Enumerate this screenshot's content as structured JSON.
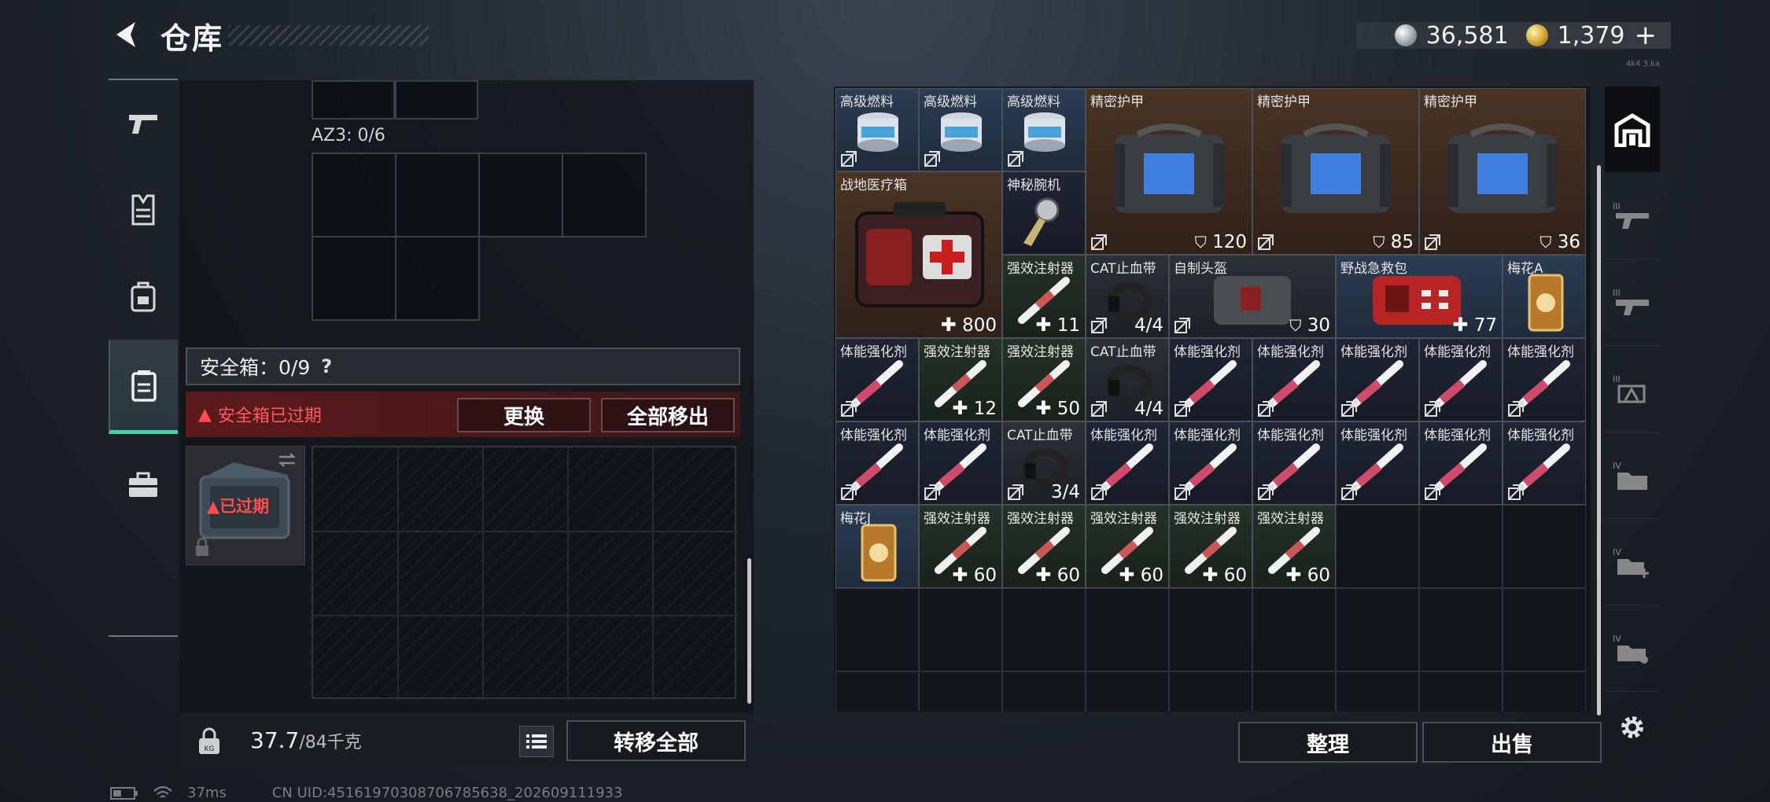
{
  "header": {
    "title": "仓库",
    "silver": "36,581",
    "gold": "1,379",
    "gold_plus": "+",
    "tiny_tag": "4k4 3:ka"
  },
  "left": {
    "az3_label": "AZ3: 0/6",
    "safe_title": "安全箱：0/9",
    "help": "?",
    "expired_msg": "安全箱已过期",
    "replace_btn": "更换",
    "move_all_out_btn": "全部移出",
    "expired_tag": "已过期",
    "weight_value": "37.7",
    "weight_max": "/84千克",
    "transfer_all_btn": "转移全部"
  },
  "inventory": {
    "sort_btn": "整理",
    "sell_btn": "出售",
    "items": [
      {
        "name": "高级燃料",
        "val": ""
      },
      {
        "name": "高级燃料",
        "val": ""
      },
      {
        "name": "高级燃料",
        "val": ""
      },
      {
        "name": "精密护甲",
        "val": "120"
      },
      {
        "name": "精密护甲",
        "val": "85"
      },
      {
        "name": "精密护甲",
        "val": "36"
      },
      {
        "name": "战地医疗箱",
        "val": "800"
      },
      {
        "name": "神秘腕机",
        "val": ""
      },
      {
        "name": "强效注射器",
        "val": "11"
      },
      {
        "name": "CAT止血带",
        "val": "4/4"
      },
      {
        "name": "自制头盔",
        "val": "30"
      },
      {
        "name": "野战急救包",
        "val": "77"
      },
      {
        "name": "梅花A",
        "val": ""
      },
      {
        "name": "体能强化剂",
        "val": ""
      },
      {
        "name": "强效注射器",
        "val": "12"
      },
      {
        "name": "强效注射器",
        "val": "50"
      },
      {
        "name": "CAT止血带",
        "val": "4/4"
      },
      {
        "name": "体能强化剂",
        "val": ""
      },
      {
        "name": "体能强化剂",
        "val": ""
      },
      {
        "name": "体能强化剂",
        "val": ""
      },
      {
        "name": "体能强化剂",
        "val": ""
      },
      {
        "name": "体能强化剂",
        "val": ""
      },
      {
        "name": "体能强化剂",
        "val": ""
      },
      {
        "name": "体能强化剂",
        "val": ""
      },
      {
        "name": "CAT止血带",
        "val": "3/4"
      },
      {
        "name": "体能强化剂",
        "val": ""
      },
      {
        "name": "体能强化剂",
        "val": ""
      },
      {
        "name": "体能强化剂",
        "val": ""
      },
      {
        "name": "体能强化剂",
        "val": ""
      },
      {
        "name": "体能强化剂",
        "val": ""
      },
      {
        "name": "体能强化剂",
        "val": ""
      },
      {
        "name": "梅花J",
        "val": ""
      },
      {
        "name": "强效注射器",
        "val": "60"
      },
      {
        "name": "强效注射器",
        "val": "60"
      },
      {
        "name": "强效注射器",
        "val": "60"
      },
      {
        "name": "强效注射器",
        "val": "60"
      },
      {
        "name": "强效注射器",
        "val": "60"
      }
    ]
  },
  "status": {
    "ping": "37ms",
    "uid": "CN UID:4516197030870678563​8_202609111933"
  }
}
